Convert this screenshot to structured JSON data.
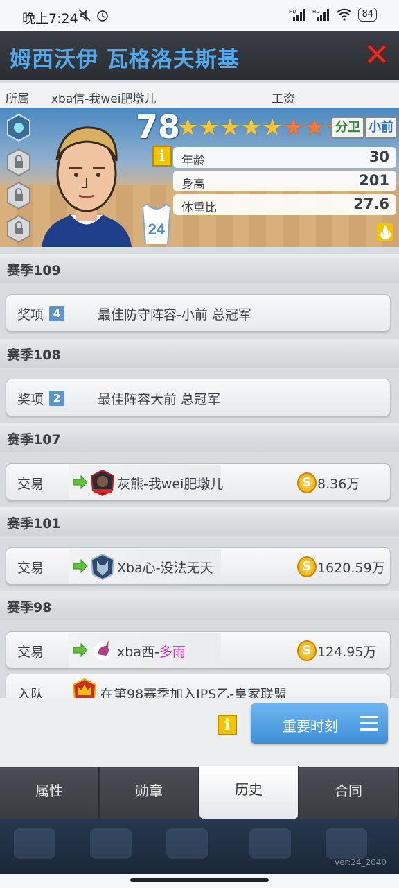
{
  "status_bar": {
    "time": "晚上7:24",
    "battery": "84",
    "icons": [
      "mute-icon",
      "alarm-icon",
      "signal-hd-icon",
      "signal-hd-icon",
      "wifi-icon",
      "battery-icon"
    ]
  },
  "header": {
    "player_name": "姆西沃伊 瓦格洛夫斯基",
    "close_icon": "close-x-icon"
  },
  "info_bar": {
    "team_label": "所属",
    "team_value": "xba信-我wei肥墩儿",
    "salary_label": "工资"
  },
  "player": {
    "rating": "78",
    "stars_total": 8,
    "stars_gold": 5,
    "positions": [
      "分卫",
      "小前"
    ],
    "jersey_number": "24",
    "stats": [
      {
        "label": "年龄",
        "value": "30"
      },
      {
        "label": "身高",
        "value": "201"
      },
      {
        "label": "体重比",
        "value": "27.6"
      }
    ]
  },
  "seasons": [
    {
      "title": "赛季109",
      "rows": [
        {
          "type": "奖项",
          "badge": "4",
          "desc": "最佳防守阵容-小前   总冠军"
        }
      ]
    },
    {
      "title": "赛季108",
      "rows": [
        {
          "type": "奖项",
          "badge": "2",
          "desc": "最佳阵容大前   总冠军"
        }
      ]
    },
    {
      "title": "赛季107",
      "rows": [
        {
          "type": "交易",
          "team": "灰熊-我wei肥墩儿",
          "money": "8.36万"
        }
      ]
    },
    {
      "title": "赛季101",
      "rows": [
        {
          "type": "交易",
          "team": "Xba心-没法无天",
          "money": "1620.59万"
        }
      ]
    },
    {
      "title": "赛季98",
      "rows": [
        {
          "type": "交易",
          "team_prefix": "xba西-",
          "team_suffix": "多雨",
          "money": "124.95万"
        },
        {
          "type": "入队",
          "desc": "在第98赛季加入JPS乙-皇家联盟"
        }
      ]
    }
  ],
  "bottom": {
    "info_icon": "info-icon",
    "moments_label": "重要时刻"
  },
  "tabs": [
    "属性",
    "勋章",
    "历史",
    "合同"
  ],
  "active_tab": "历史",
  "footer": {
    "version": "ver:24_2040"
  }
}
